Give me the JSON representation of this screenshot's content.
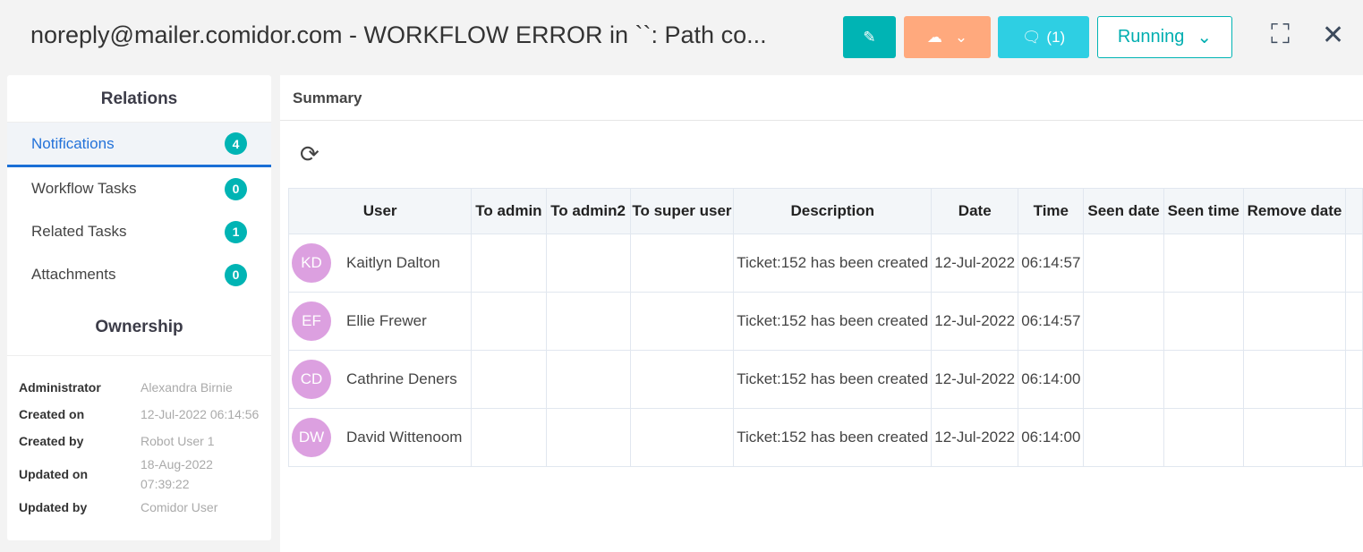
{
  "header": {
    "title": "noreply@mailer.comidor.com - WORKFLOW ERROR in ``: Path co...",
    "comment_label": "(1)",
    "status": "Running"
  },
  "colors": {
    "edit": "#00b4b4",
    "download": "#ffa97d",
    "comments": "#2ecfe3",
    "accent": "#1a6fd6",
    "avatar": "#dca0e0"
  },
  "relations": {
    "title": "Relations",
    "items": [
      {
        "label": "Notifications",
        "count": "4"
      },
      {
        "label": "Workflow Tasks",
        "count": "0"
      },
      {
        "label": "Related Tasks",
        "count": "1"
      },
      {
        "label": "Attachments",
        "count": "0"
      }
    ]
  },
  "ownership": {
    "title": "Ownership",
    "rows": [
      {
        "label": "Administrator",
        "value": "Alexandra Birnie"
      },
      {
        "label": "Created on",
        "value": "12-Jul-2022 06:14:56"
      },
      {
        "label": "Created by",
        "value": "Robot User 1"
      },
      {
        "label": "Updated on",
        "value": "18-Aug-2022 07:39:22"
      },
      {
        "label": "Updated by",
        "value": "Comidor User"
      }
    ]
  },
  "summary": {
    "title": "Summary"
  },
  "table": {
    "columns": [
      "User",
      "To admin",
      "To admin2",
      "To super user",
      "Description",
      "Date",
      "Time",
      "Seen date",
      "Seen time",
      "Remove date"
    ],
    "rows": [
      {
        "initials": "KD",
        "user": "Kaitlyn Dalton",
        "description": "Ticket:152 has been created",
        "date": "12-Jul-2022",
        "time": "06:14:57"
      },
      {
        "initials": "EF",
        "user": "Ellie Frewer",
        "description": "Ticket:152 has been created",
        "date": "12-Jul-2022",
        "time": "06:14:57"
      },
      {
        "initials": "CD",
        "user": "Cathrine Deners",
        "description": "Ticket:152 has been created",
        "date": "12-Jul-2022",
        "time": "06:14:00"
      },
      {
        "initials": "DW",
        "user": "David Wittenoom",
        "description": "Ticket:152 has been created",
        "date": "12-Jul-2022",
        "time": "06:14:00"
      }
    ]
  }
}
